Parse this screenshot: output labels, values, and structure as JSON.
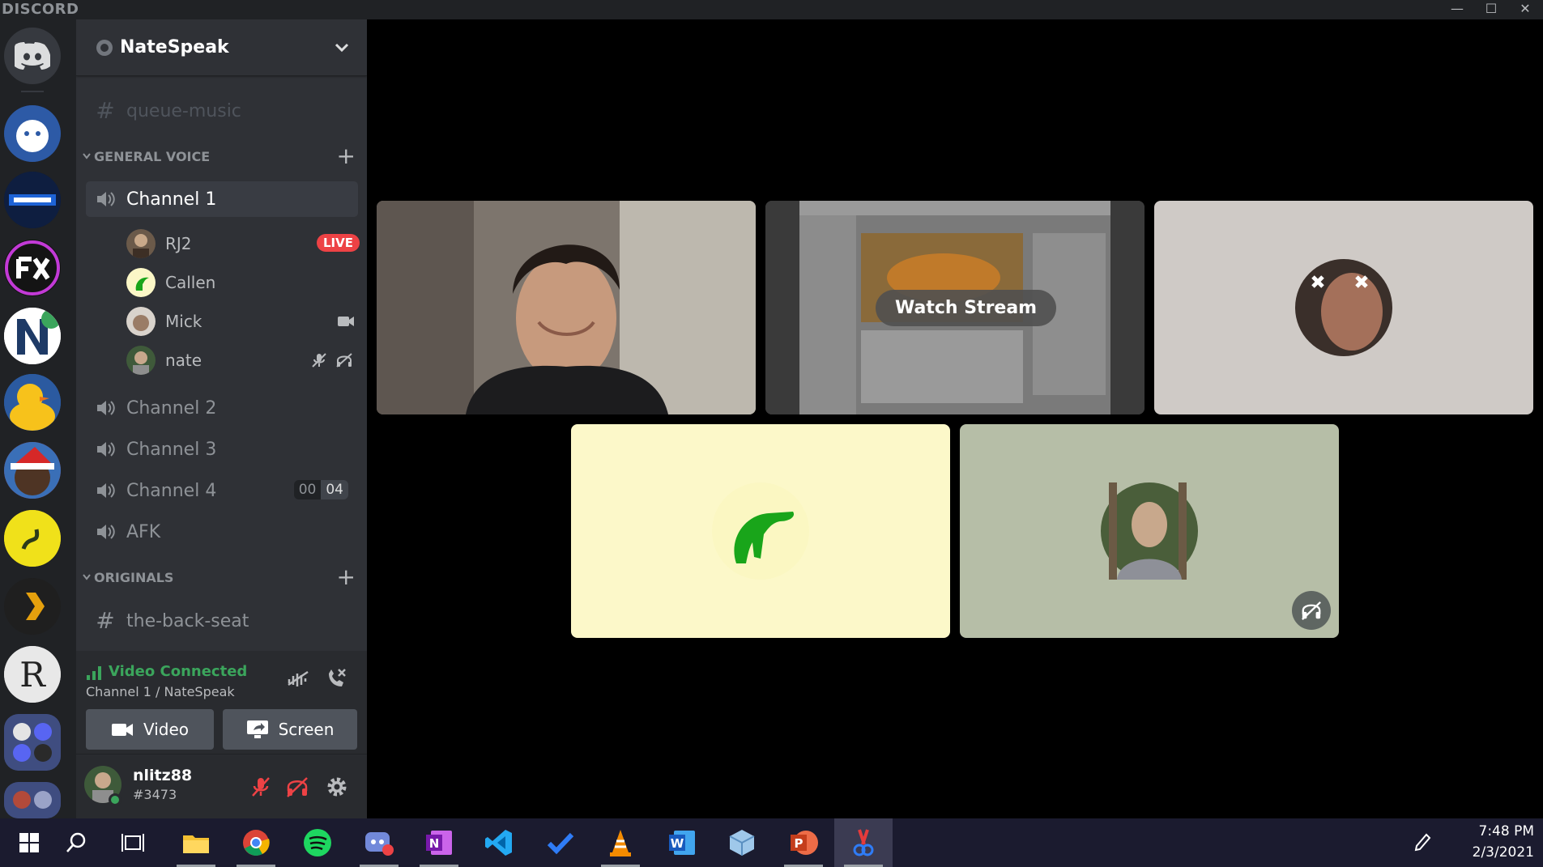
{
  "app": {
    "brand": "DISCORD"
  },
  "window_controls": {
    "minimize": "—",
    "maximize": "☐",
    "close": "✕"
  },
  "guild": {
    "name": "NateSpeak"
  },
  "channels": {
    "partial_top": "queue-music",
    "general_voice_category": "GENERAL VOICE",
    "voice": [
      {
        "label": "Channel 1",
        "selected": true
      },
      {
        "label": "Channel 2"
      },
      {
        "label": "Channel 3"
      },
      {
        "label": "Channel 4",
        "limit_used": "00",
        "limit_max": "04"
      },
      {
        "label": "AFK"
      }
    ],
    "originals_category": "ORIGINALS",
    "text": [
      {
        "label": "the-back-seat"
      }
    ]
  },
  "voice_users": [
    {
      "name": "RJ2",
      "badge": "LIVE"
    },
    {
      "name": "Callen"
    },
    {
      "name": "Mick"
    },
    {
      "name": "nate"
    }
  ],
  "voice_panel": {
    "status": "Video Connected",
    "location": "Channel 1 / NateSpeak",
    "video_button": "Video",
    "screen_button": "Screen"
  },
  "user_panel": {
    "username": "nlitz88",
    "discriminator": "#3473"
  },
  "stage": {
    "watch_stream": "Watch Stream"
  },
  "taskbar": {
    "time": "7:48 PM",
    "date": "2/3/2021"
  },
  "colors": {
    "accent_green": "#3ba55c",
    "live_red": "#ed4245",
    "sidebar_bg": "#2f3136",
    "rail_bg": "#202225",
    "panel_bg": "#292b2f"
  }
}
